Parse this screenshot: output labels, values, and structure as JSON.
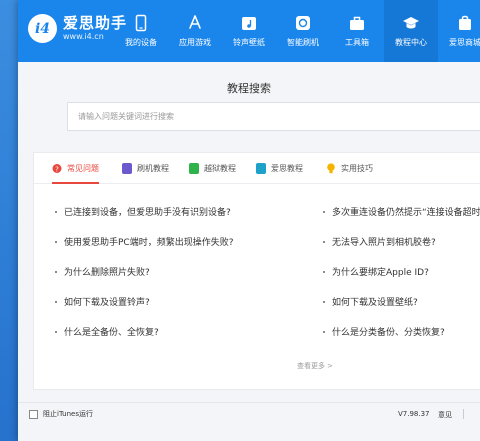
{
  "app": {
    "logo_mark": "i4",
    "name": "爱思助手",
    "url": "www.i4.cn"
  },
  "nav": {
    "items": [
      {
        "label": "我的设备",
        "icon": "phone-icon"
      },
      {
        "label": "应用游戏",
        "icon": "app-store-icon"
      },
      {
        "label": "铃声壁纸",
        "icon": "music-icon"
      },
      {
        "label": "智能刷机",
        "icon": "flash-icon"
      },
      {
        "label": "工具箱",
        "icon": "toolbox-icon"
      },
      {
        "label": "教程中心",
        "icon": "graduation-cap-icon"
      },
      {
        "label": "爱思商城",
        "icon": "shop-icon"
      }
    ],
    "active_index": 5
  },
  "search": {
    "title": "教程搜索",
    "placeholder": "请输入问题关键词进行搜索"
  },
  "tabs": [
    {
      "label": "常见问题",
      "icon": "question-icon",
      "color": "#e8473e"
    },
    {
      "label": "刷机教程",
      "icon": "book-icon",
      "color": "#6a5acd"
    },
    {
      "label": "越狱教程",
      "icon": "book-icon",
      "color": "#2db34a"
    },
    {
      "label": "爱思教程",
      "icon": "book-icon",
      "color": "#1da1c8"
    },
    {
      "label": "实用技巧",
      "icon": "bulb-icon",
      "color": "#f5b400"
    }
  ],
  "questions_left": [
    "已连接到设备，但爱思助手没有识别设备?",
    "使用爱思助手PC端时，频繁出现操作失败?",
    "为什么删除照片失败?",
    "如何下载及设置铃声?",
    "什么是全备份、全恢复?"
  ],
  "questions_right": [
    "多次重连设备仍然提示“连接设备超时”",
    "无法导入照片到相机胶卷?",
    "为什么要绑定Apple ID?",
    "如何下载及设置壁纸?",
    "什么是分类备份、分类恢复?"
  ],
  "more_label": "查看更多 >",
  "footer": {
    "itunes_label": "阻止iTunes运行",
    "version": "V7.98.37",
    "feedback": "意见"
  },
  "colors": {
    "header": "#1a86ec",
    "active_tab": "#e8473e"
  }
}
